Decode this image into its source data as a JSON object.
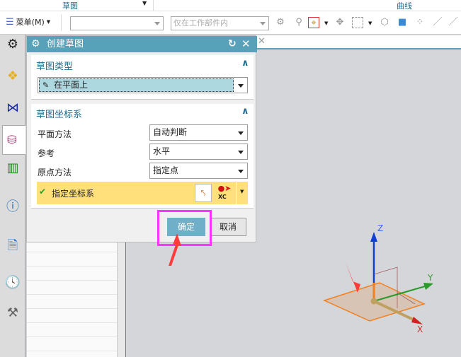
{
  "ribbon": {
    "group1": "草图",
    "group2": "曲线"
  },
  "toolbar": {
    "menu_label": "菜单(M)",
    "filter_value": "",
    "scope_value": "仅在工作部件内"
  },
  "dialog": {
    "title": "创建草图",
    "section_type": {
      "heading": "草图类型",
      "selected": "在平面上"
    },
    "section_csys": {
      "heading": "草图坐标系",
      "rows": [
        {
          "label": "平面方法",
          "value": "自动判断"
        },
        {
          "label": "参考",
          "value": "水平"
        },
        {
          "label": "原点方法",
          "value": "指定点"
        }
      ],
      "specify_csys": "指定坐标系",
      "xc_label": "XC"
    },
    "ok": "确定",
    "cancel": "取消"
  },
  "viewport": {
    "axis_x": "X",
    "axis_y": "Y",
    "axis_z": "Z"
  },
  "colors": {
    "title_bar": "#57a1b9",
    "highlight": "#ffe07a",
    "annotation": "#ff33ff",
    "arrow": "#ff3b3b"
  }
}
